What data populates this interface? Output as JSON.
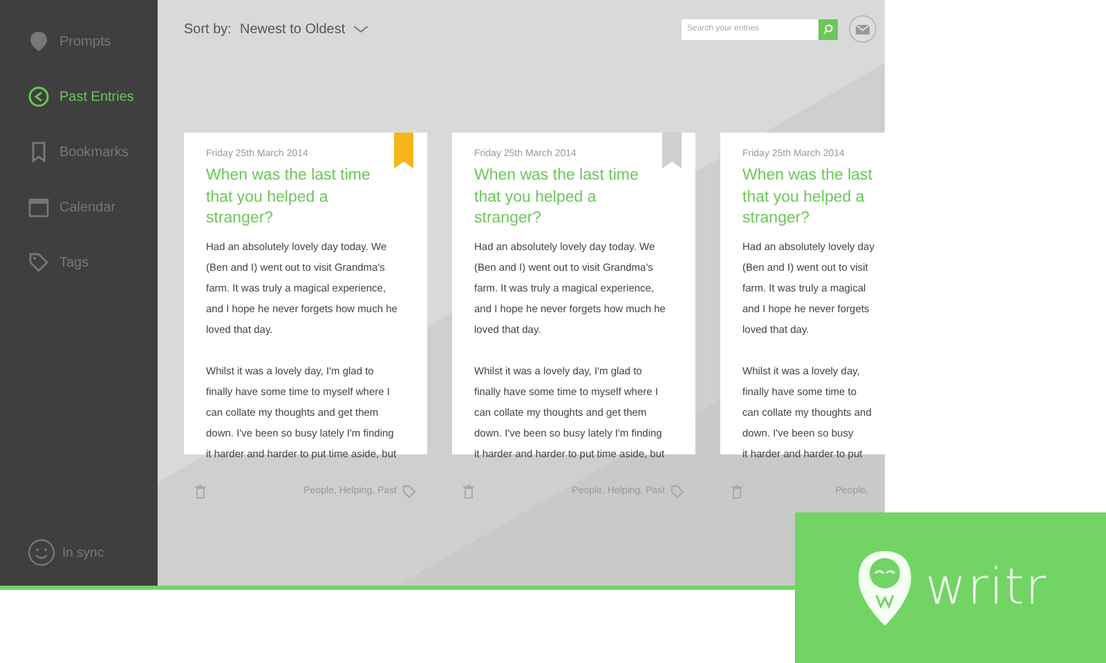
{
  "sidebar": {
    "items": [
      {
        "label": "Prompts",
        "selected": false
      },
      {
        "label": "Past Entries",
        "selected": true
      },
      {
        "label": "Bookmarks",
        "selected": false
      },
      {
        "label": "Calendar",
        "selected": false
      },
      {
        "label": "Tags",
        "selected": false
      }
    ],
    "status": "In sync"
  },
  "toolbar": {
    "sort_label": "Sort by:",
    "sort_value": "Newest to Oldest",
    "search": {
      "placeholder": "Search your entries"
    }
  },
  "entries": [
    {
      "date": "Friday 25th March 2014",
      "bookmarked": true,
      "title_lines": [
        "When was the last time",
        "that you helped a",
        "stranger?"
      ],
      "paragraphs": [
        [
          "Had an absolutely lovely day today. We",
          "(Ben and I) went out to visit Grandma's",
          "farm. It was truly a magical experience,",
          "and I hope he never forgets how much he",
          "loved that day."
        ],
        [
          "Whilst it was a lovely day, I'm glad to",
          "finally have some time to myself where I",
          "can collate my thoughts and get them",
          "down. I've been so busy lately I'm finding",
          "it harder and harder to put time aside, but"
        ]
      ],
      "tags": "People, Helping, Past"
    },
    {
      "date": "Friday 25th March 2014",
      "bookmarked": false,
      "title_lines": [
        "When was the last time",
        "that you helped a",
        "stranger?"
      ],
      "paragraphs": [
        [
          "Had an absolutely lovely day today. We",
          "(Ben and I) went out to visit Grandma's",
          "farm. It was truly a magical experience,",
          "and I hope he never forgets how much he",
          "loved that day."
        ],
        [
          "Whilst it was a lovely day, I'm glad to",
          "finally have some time to myself where I",
          "can collate my thoughts and get them",
          "down. I've been so busy lately I'm finding",
          "it harder and harder to put time aside, but"
        ]
      ],
      "tags": "People, Helping, Past"
    },
    {
      "date": "Friday 25th March 2014",
      "title_lines": [
        "When was the last",
        "that you helped a",
        "stranger?"
      ],
      "paragraphs": [
        [
          "Had an absolutely lovely day",
          "(Ben and I) went out to visit",
          "farm. It was truly a magical",
          "and I hope he never forgets",
          "loved that day."
        ],
        [
          "Whilst it was a lovely day,",
          "finally have some time to",
          "can collate my thoughts and",
          "down. I've been so busy",
          "it harder and harder to put"
        ]
      ],
      "tags": "People,"
    }
  ],
  "brand": {
    "name": "writr"
  }
}
